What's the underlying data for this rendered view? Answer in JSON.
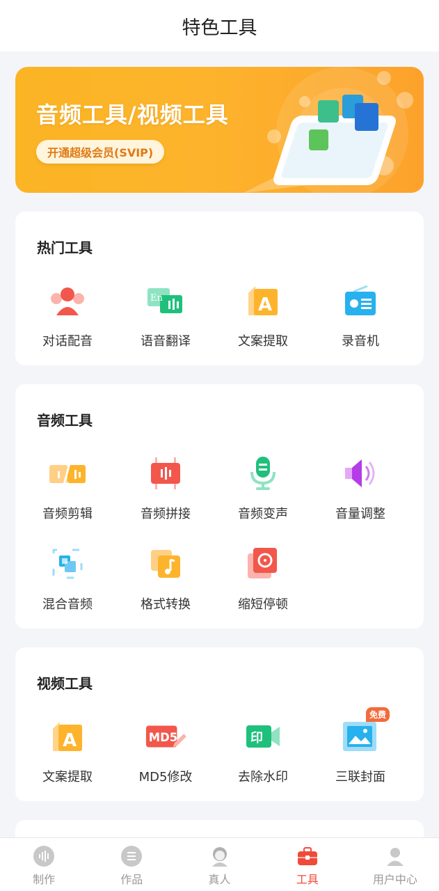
{
  "header": {
    "title": "特色工具"
  },
  "banner": {
    "title": "音频工具/视频工具",
    "button": "开通超级会员(SVIP)"
  },
  "sections": {
    "hot": {
      "title": "热门工具",
      "items": [
        {
          "label": "对话配音",
          "icon": "dialog-dubbing-icon"
        },
        {
          "label": "语音翻译",
          "icon": "voice-translate-icon"
        },
        {
          "label": "文案提取",
          "icon": "text-extract-icon"
        },
        {
          "label": "录音机",
          "icon": "recorder-icon"
        }
      ]
    },
    "audio": {
      "title": "音频工具",
      "items": [
        {
          "label": "音频剪辑",
          "icon": "audio-cut-icon"
        },
        {
          "label": "音频拼接",
          "icon": "audio-join-icon"
        },
        {
          "label": "音频变声",
          "icon": "voice-change-icon"
        },
        {
          "label": "音量调整",
          "icon": "volume-adjust-icon"
        },
        {
          "label": "混合音频",
          "icon": "audio-mix-icon"
        },
        {
          "label": "格式转换",
          "icon": "format-convert-icon"
        },
        {
          "label": "缩短停顿",
          "icon": "shorten-pause-icon"
        }
      ]
    },
    "video": {
      "title": "视频工具",
      "items": [
        {
          "label": "文案提取",
          "icon": "text-extract-icon"
        },
        {
          "label": "MD5修改",
          "icon": "md5-edit-icon"
        },
        {
          "label": "去除水印",
          "icon": "remove-watermark-icon"
        },
        {
          "label": "三联封面",
          "icon": "triple-cover-icon",
          "badge": "免费"
        }
      ]
    }
  },
  "tabbar": {
    "items": [
      {
        "label": "制作",
        "icon": "waveform-icon"
      },
      {
        "label": "作品",
        "icon": "works-list-icon"
      },
      {
        "label": "真人",
        "icon": "person-avatar-icon"
      },
      {
        "label": "工具",
        "icon": "toolbox-icon",
        "active": true
      },
      {
        "label": "用户中心",
        "icon": "user-icon"
      }
    ]
  },
  "colors": {
    "accent": "#f04a3a",
    "banner": "#fdb42c",
    "background": "#f4f5f9"
  }
}
